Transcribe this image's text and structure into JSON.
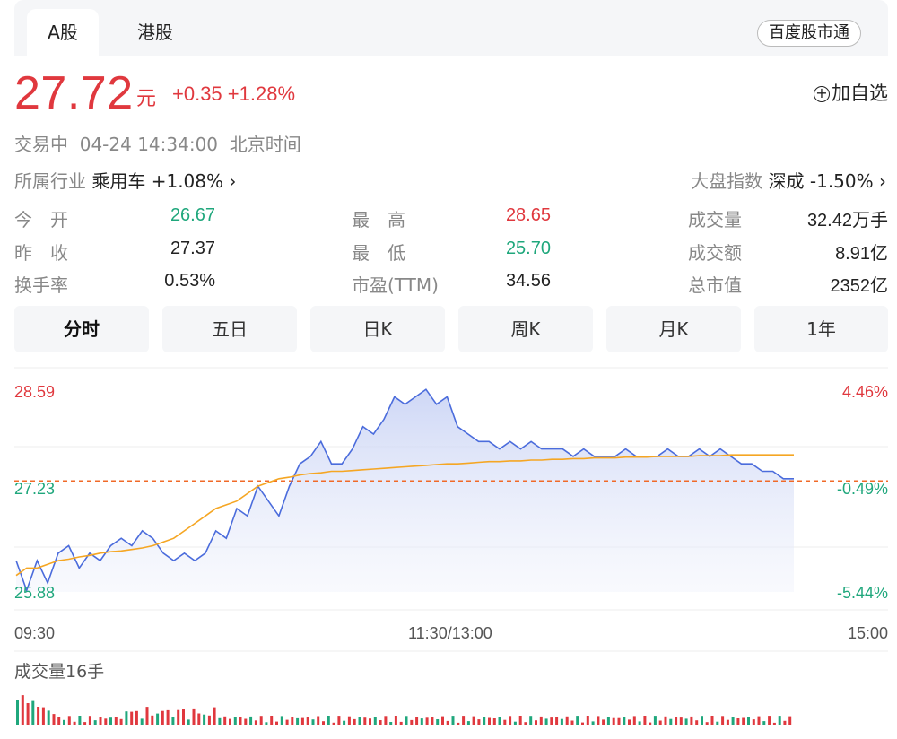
{
  "tabs": [
    {
      "label": "A股",
      "active": true
    },
    {
      "label": "港股",
      "active": false
    }
  ],
  "tong_button": "百度股市通",
  "quote": {
    "price": "27.72",
    "unit": "元",
    "change": "+0.35",
    "change_pct": "+1.28%",
    "status": "交易中",
    "datetime": "04-24 14:34:00",
    "timezone": "北京时间"
  },
  "add_watch": "加自选",
  "industry": {
    "label": "所属行业",
    "name": "乘用车",
    "change": "+1.08%"
  },
  "market_index": {
    "label": "大盘指数",
    "name": "深成",
    "change": "-1.50%"
  },
  "stats": [
    {
      "label": "今　开",
      "value": "26.67",
      "color": "green"
    },
    {
      "label": "最　高",
      "value": "28.65",
      "color": "red"
    },
    {
      "label": "成交量",
      "value": "32.42万手",
      "color": "normal"
    },
    {
      "label": "昨　收",
      "value": "27.37",
      "color": "normal"
    },
    {
      "label": "最　低",
      "value": "25.70",
      "color": "green"
    },
    {
      "label": "成交额",
      "value": "8.91亿",
      "color": "normal"
    },
    {
      "label": "换手率",
      "value": "0.53%",
      "color": "normal"
    },
    {
      "label": "市盈(TTM)",
      "value": "34.56",
      "color": "normal"
    },
    {
      "label": "总市值",
      "value": "2352亿",
      "color": "normal"
    }
  ],
  "chart_tabs": [
    "分时",
    "五日",
    "日K",
    "周K",
    "月K",
    "1年"
  ],
  "chart": {
    "y_left": [
      "28.59",
      "27.23",
      "25.88"
    ],
    "y_right": [
      "4.46%",
      "-0.49%",
      "-5.44%"
    ],
    "x_labels": [
      "09:30",
      "11:30/13:00",
      "15:00"
    ],
    "volume_label": "成交量16手"
  },
  "chart_data": {
    "type": "line",
    "ylim": [
      25.88,
      28.59
    ],
    "prev_close": 27.37,
    "series": [
      {
        "values": [
          26.3,
          25.9,
          26.3,
          26.0,
          26.4,
          26.5,
          26.2,
          26.4,
          26.3,
          26.5,
          26.6,
          26.5,
          26.7,
          26.6,
          26.4,
          26.3,
          26.4,
          26.3,
          26.4,
          26.7,
          26.6,
          27.0,
          26.9,
          27.3,
          27.1,
          26.9,
          27.3,
          27.6,
          27.7,
          27.9,
          27.6,
          27.6,
          27.8,
          28.1,
          28.0,
          28.2,
          28.5,
          28.4,
          28.5,
          28.6,
          28.4,
          28.5,
          28.1,
          28.0,
          27.9,
          27.9,
          27.8,
          27.9,
          27.8,
          27.9,
          27.8,
          27.8,
          27.8,
          27.7,
          27.8,
          27.7,
          27.7,
          27.7,
          27.8,
          27.7,
          27.7,
          27.7,
          27.8,
          27.7,
          27.7,
          27.8,
          27.7,
          27.8,
          27.7,
          27.6,
          27.6,
          27.5,
          27.5,
          27.4,
          27.4
        ]
      },
      {
        "values": [
          26.1,
          26.2,
          26.2,
          26.25,
          26.3,
          26.32,
          26.35,
          26.37,
          26.4,
          26.42,
          26.43,
          26.45,
          26.47,
          26.5,
          26.55,
          26.6,
          26.7,
          26.8,
          26.9,
          27.0,
          27.05,
          27.1,
          27.2,
          27.3,
          27.35,
          27.4,
          27.42,
          27.45,
          27.47,
          27.48,
          27.5,
          27.5,
          27.51,
          27.52,
          27.53,
          27.54,
          27.55,
          27.56,
          27.57,
          27.58,
          27.59,
          27.6,
          27.6,
          27.61,
          27.62,
          27.63,
          27.63,
          27.64,
          27.64,
          27.65,
          27.65,
          27.66,
          27.66,
          27.67,
          27.67,
          27.68,
          27.68,
          27.68,
          27.69,
          27.69,
          27.69,
          27.7,
          27.7,
          27.7,
          27.7,
          27.71,
          27.71,
          27.71,
          27.72,
          27.72,
          27.72,
          27.72,
          27.72,
          27.72,
          27.72
        ]
      }
    ]
  },
  "colors": {
    "up": "#e0383e",
    "down": "#1fa77c",
    "price_line": "#4b6cdc",
    "avg_line": "#f5a623",
    "prev_close_line": "#f06a28"
  }
}
